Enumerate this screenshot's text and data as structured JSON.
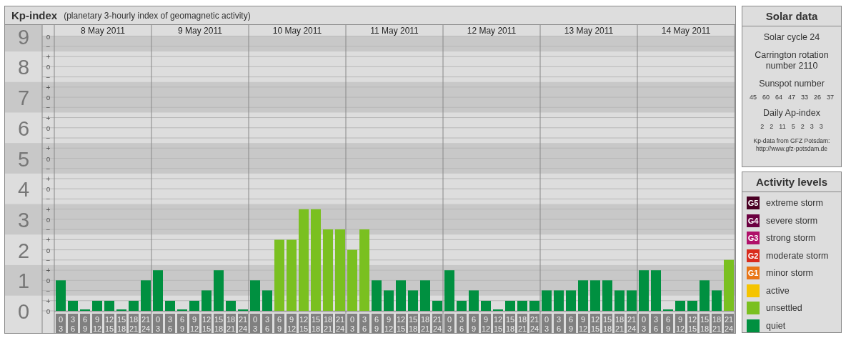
{
  "title": {
    "name": "Kp-index",
    "subtitle": "(planetary 3-hourly index of geomagnetic activity)"
  },
  "chart": {
    "axis_marks": [
      "o",
      "−",
      "+",
      "o",
      "−",
      "+",
      "o",
      "−",
      "+",
      "o",
      "−",
      "+",
      "o",
      "−",
      "+",
      "o",
      "−",
      "+",
      "o",
      "−",
      "+",
      "o",
      "−",
      "+",
      "o",
      "−",
      "+",
      "o"
    ],
    "days": [
      {
        "date": "8 May 2011",
        "slots": [
          {
            "start": "0",
            "end": "3"
          },
          {
            "start": "3",
            "end": "6"
          },
          {
            "start": "6",
            "end": "9"
          },
          {
            "start": "9",
            "end": "12"
          },
          {
            "start": "12",
            "end": "15"
          },
          {
            "start": "15",
            "end": "18"
          },
          {
            "start": "18",
            "end": "21"
          },
          {
            "start": "21",
            "end": "24"
          }
        ]
      },
      {
        "date": "9 May 2011",
        "slots": [
          {
            "start": "0",
            "end": "3"
          },
          {
            "start": "3",
            "end": "6"
          },
          {
            "start": "6",
            "end": "9"
          },
          {
            "start": "9",
            "end": "12"
          },
          {
            "start": "12",
            "end": "15"
          },
          {
            "start": "15",
            "end": "18"
          },
          {
            "start": "18",
            "end": "21"
          },
          {
            "start": "21",
            "end": "24"
          }
        ]
      },
      {
        "date": "10 May 2011",
        "slots": [
          {
            "start": "0",
            "end": "3"
          },
          {
            "start": "3",
            "end": "6"
          },
          {
            "start": "6",
            "end": "9"
          },
          {
            "start": "9",
            "end": "12"
          },
          {
            "start": "12",
            "end": "15"
          },
          {
            "start": "15",
            "end": "18"
          },
          {
            "start": "18",
            "end": "21"
          },
          {
            "start": "21",
            "end": "24"
          }
        ]
      },
      {
        "date": "11 May 2011",
        "slots": [
          {
            "start": "0",
            "end": "3"
          },
          {
            "start": "3",
            "end": "6"
          },
          {
            "start": "6",
            "end": "9"
          },
          {
            "start": "9",
            "end": "12"
          },
          {
            "start": "12",
            "end": "15"
          },
          {
            "start": "15",
            "end": "18"
          },
          {
            "start": "18",
            "end": "21"
          },
          {
            "start": "21",
            "end": "24"
          }
        ]
      },
      {
        "date": "12 May 2011",
        "slots": [
          {
            "start": "0",
            "end": "3"
          },
          {
            "start": "3",
            "end": "6"
          },
          {
            "start": "6",
            "end": "9"
          },
          {
            "start": "9",
            "end": "12"
          },
          {
            "start": "12",
            "end": "15"
          },
          {
            "start": "15",
            "end": "18"
          },
          {
            "start": "18",
            "end": "21"
          },
          {
            "start": "21",
            "end": "24"
          }
        ]
      },
      {
        "date": "13 May 2011",
        "slots": [
          {
            "start": "0",
            "end": "3"
          },
          {
            "start": "3",
            "end": "6"
          },
          {
            "start": "6",
            "end": "9"
          },
          {
            "start": "9",
            "end": "12"
          },
          {
            "start": "12",
            "end": "15"
          },
          {
            "start": "15",
            "end": "18"
          },
          {
            "start": "18",
            "end": "21"
          },
          {
            "start": "21",
            "end": "24"
          }
        ]
      },
      {
        "date": "14 May 2011",
        "slots": [
          {
            "start": "0",
            "end": "3"
          },
          {
            "start": "3",
            "end": "6"
          },
          {
            "start": "6",
            "end": "9"
          },
          {
            "start": "9",
            "end": "12"
          },
          {
            "start": "12",
            "end": "15"
          },
          {
            "start": "15",
            "end": "18"
          },
          {
            "start": "18",
            "end": "21"
          },
          {
            "start": "21",
            "end": "24"
          }
        ]
      }
    ],
    "chart_data": {
      "type": "bar",
      "grid": true,
      "ylim": [
        0,
        9
      ],
      "yticks": [
        0,
        1,
        2,
        3,
        4,
        5,
        6,
        7,
        8,
        9
      ],
      "values": [
        1,
        0.33,
        0,
        0.33,
        0.33,
        0,
        0.33,
        1,
        1.33,
        0.33,
        0,
        0.33,
        0.67,
        1.33,
        0.33,
        0,
        1,
        0.67,
        2.33,
        2.33,
        3.33,
        3.33,
        2.67,
        2.67,
        2,
        2.67,
        1,
        0.67,
        1,
        0.67,
        1,
        0.33,
        1.33,
        0.33,
        0.67,
        0.33,
        0,
        0.33,
        0.33,
        0.33,
        0.67,
        0.67,
        0.67,
        1,
        1,
        1,
        0.67,
        0.67,
        1.33,
        1.33,
        0,
        0.33,
        0.33,
        1,
        0.67,
        1.67
      ]
    }
  },
  "solar_data": {
    "title": "Solar data",
    "solar_cycle": "Solar cycle 24",
    "carrington": "Carrington rotation number 2110",
    "sunspot_label": "Sunspot number",
    "sunspot_numbers": [
      "45",
      "60",
      "64",
      "47",
      "33",
      "26",
      "37"
    ],
    "ap_label": "Daily Ap-index",
    "ap_values": [
      "2",
      "2",
      "11",
      "5",
      "2",
      "3",
      "3"
    ],
    "credit": [
      "Kp-data from GFZ Potsdam:",
      "http://www.gfz-potsdam.de"
    ]
  },
  "activity_levels": {
    "title": "Activity levels",
    "items": [
      {
        "badge": "G5",
        "label": "extreme storm",
        "color": "#4a0024"
      },
      {
        "badge": "G4",
        "label": "severe storm",
        "color": "#6b0040"
      },
      {
        "badge": "G3",
        "label": "strong storm",
        "color": "#b0106a"
      },
      {
        "badge": "G2",
        "label": "moderate storm",
        "color": "#d92b1d"
      },
      {
        "badge": "G1",
        "label": "minor storm",
        "color": "#e97516"
      },
      {
        "label": "active",
        "color": "#f5c400"
      },
      {
        "label": "unsettled",
        "color": "#7ac020"
      },
      {
        "label": "quiet",
        "color": "#009040"
      }
    ]
  }
}
